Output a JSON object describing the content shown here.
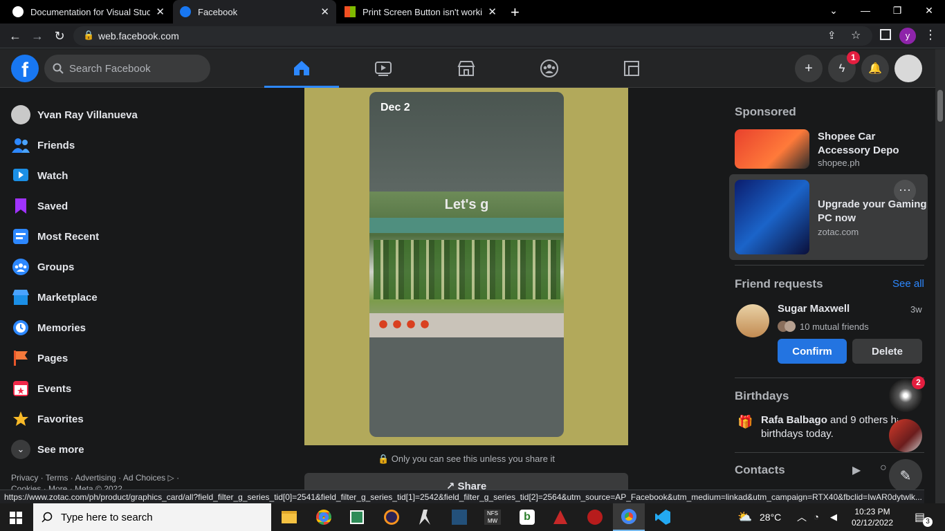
{
  "browser": {
    "tabs": [
      {
        "title": "Documentation for Visual Studio"
      },
      {
        "title": "Facebook"
      },
      {
        "title": "Print Screen Button isn't working"
      }
    ],
    "url": "web.facebook.com",
    "profile_initial": "y",
    "status_url": "https://www.zotac.com/ph/product/graphics_card/all?field_filter_g_series_tid[0]=2541&field_filter_g_series_tid[1]=2542&field_filter_g_series_tid[2]=2564&utm_source=AP_Facebook&utm_medium=linkad&utm_campaign=RTX40&fbclid=IwAR0dytwlk..."
  },
  "header": {
    "logo": "f",
    "search_placeholder": "Search Facebook",
    "messenger_badge": "1"
  },
  "sidebar": {
    "profile_name": "Yvan Ray Villanueva",
    "items": [
      {
        "label": "Friends",
        "icon": "friends-icon"
      },
      {
        "label": "Watch",
        "icon": "watch-icon"
      },
      {
        "label": "Saved",
        "icon": "saved-icon"
      },
      {
        "label": "Most Recent",
        "icon": "most-recent-icon"
      },
      {
        "label": "Groups",
        "icon": "groups-icon"
      },
      {
        "label": "Marketplace",
        "icon": "marketplace-icon"
      },
      {
        "label": "Memories",
        "icon": "memories-icon"
      },
      {
        "label": "Pages",
        "icon": "pages-icon"
      },
      {
        "label": "Events",
        "icon": "events-icon"
      },
      {
        "label": "Favorites",
        "icon": "favorites-icon"
      }
    ],
    "see_more": "See more",
    "footer": "Privacy · Terms · Advertising · Ad Choices ▷ ·",
    "footer2": "Cookies · More · Meta © 2022"
  },
  "story": {
    "date": "Dec 2",
    "overlay_text": "Let's g",
    "privacy_note": "Only you can see this unless you share it",
    "share_label": "Share"
  },
  "rightrail": {
    "sponsored_title": "Sponsored",
    "ads": [
      {
        "title": "Shopee Car Accessory Depo",
        "domain": "shopee.ph"
      },
      {
        "title": "Upgrade your Gaming PC now",
        "domain": "zotac.com"
      }
    ],
    "friend_requests_title": "Friend requests",
    "see_all": "See all",
    "request": {
      "name": "Sugar Maxwell",
      "time": "3w",
      "mutual": "10 mutual friends",
      "confirm": "Confirm",
      "delete": "Delete"
    },
    "birthdays_title": "Birthdays",
    "birthday_name": "Rafa Balbago",
    "birthday_rest": " and 9 others have",
    "birthday_line2": "birthdays today.",
    "birthday_badge": "2",
    "contacts_title": "Contacts"
  },
  "taskbar": {
    "search_placeholder": "Type here to search",
    "weather": "28°C",
    "time": "10:23 PM",
    "date": "02/12/2022",
    "notif_count": "3"
  }
}
